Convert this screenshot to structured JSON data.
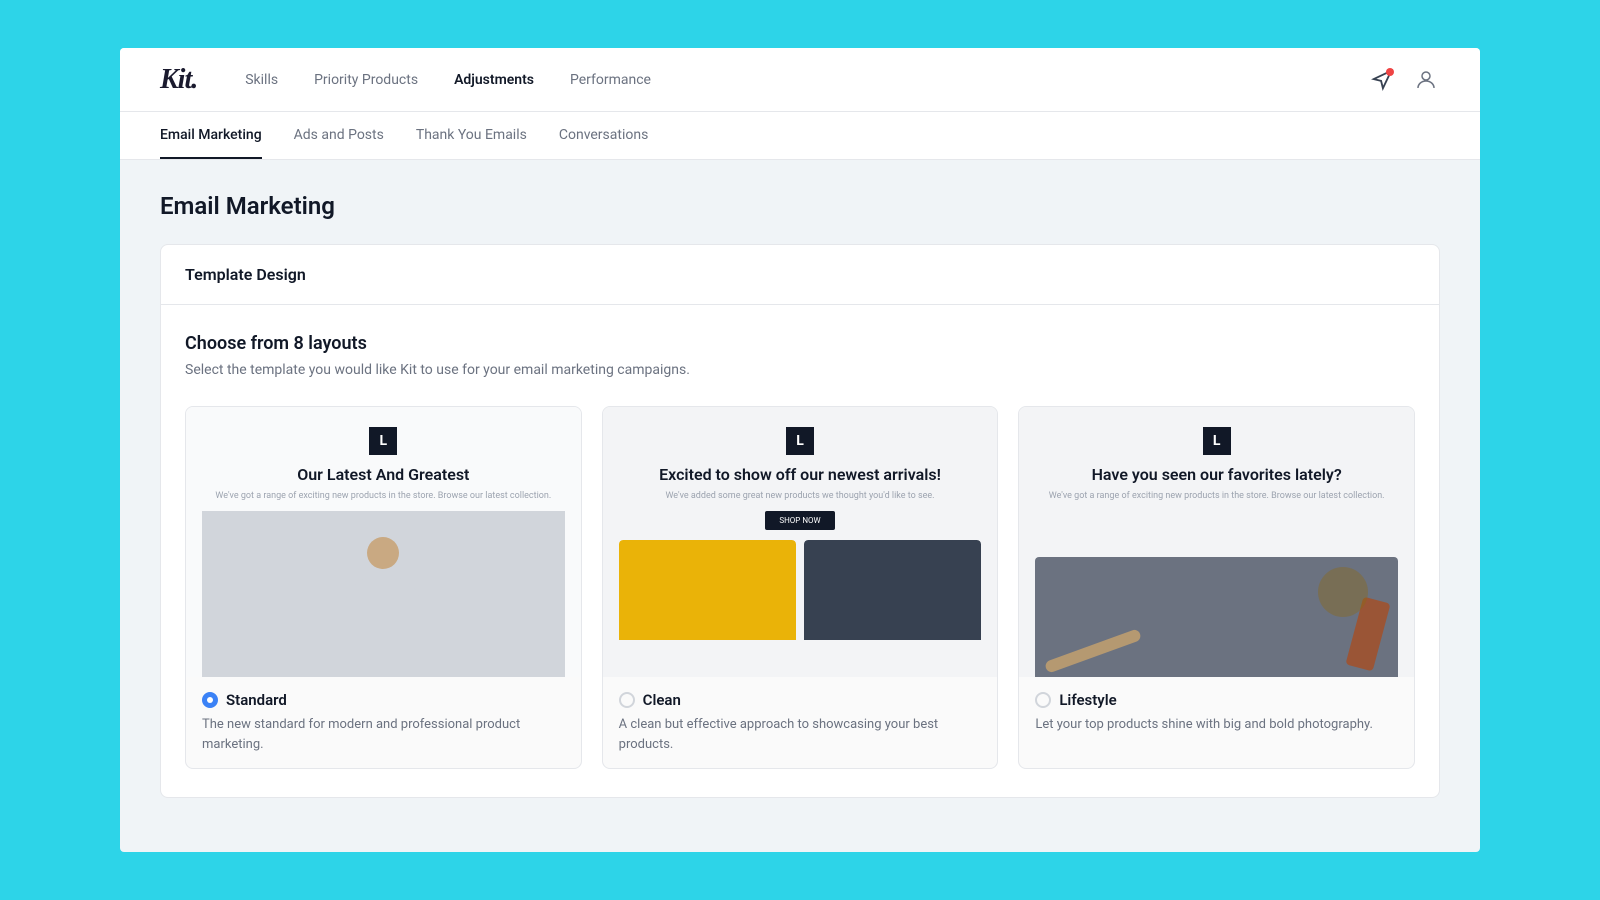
{
  "app": {
    "logo": "Kit.",
    "nav": {
      "items": [
        {
          "label": "Skills",
          "active": false
        },
        {
          "label": "Priority Products",
          "active": false
        },
        {
          "label": "Adjustments",
          "active": true
        },
        {
          "label": "Performance",
          "active": false
        }
      ]
    },
    "sub_nav": {
      "items": [
        {
          "label": "Email Marketing",
          "active": true
        },
        {
          "label": "Ads and Posts",
          "active": false
        },
        {
          "label": "Thank You Emails",
          "active": false
        },
        {
          "label": "Conversations",
          "active": false
        }
      ]
    }
  },
  "page": {
    "title": "Email Marketing",
    "card": {
      "header": "Template Design",
      "layouts_title": "Choose from 8 layouts",
      "layouts_subtitle": "Select the template you would like Kit to use for your email marketing campaigns.",
      "templates": [
        {
          "id": "standard",
          "name": "Standard",
          "description": "The new standard for modern and professional product marketing.",
          "selected": true,
          "headline": "Our Latest And Greatest",
          "subtext": "We've got a range of exciting new products in the store. Browse our latest collection."
        },
        {
          "id": "clean",
          "name": "Clean",
          "description": "A clean but effective approach to showcasing your best products.",
          "selected": false,
          "headline": "Excited to show off our newest arrivals!",
          "subtext": "We've added some great new products we thought you'd like to see.",
          "btn_label": "SHOP NOW"
        },
        {
          "id": "lifestyle",
          "name": "Lifestyle",
          "description": "Let your top products shine with big and bold photography.",
          "selected": false,
          "headline": "Have you seen our favorites lately?",
          "subtext": "We've got a range of exciting new products in the store. Browse our latest collection."
        }
      ]
    }
  },
  "icons": {
    "megaphone": "📣",
    "user": "👤",
    "logo_letter": "L"
  }
}
